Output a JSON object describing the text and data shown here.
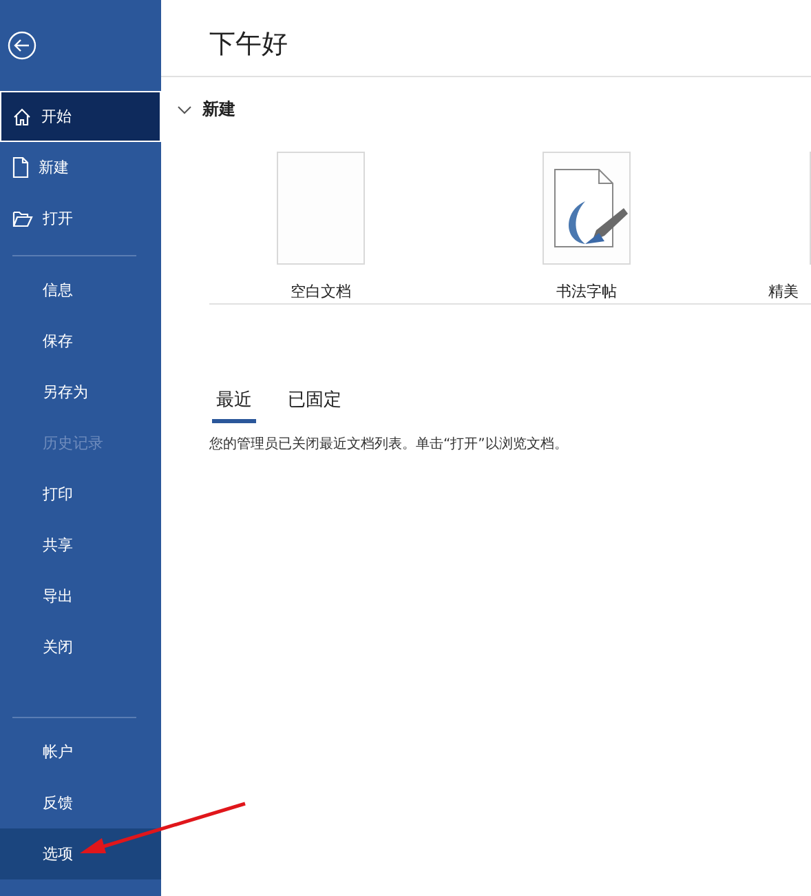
{
  "sidebar": {
    "top_items": [
      {
        "label": "开始",
        "selected": true,
        "highlighted": false,
        "disabled": false
      },
      {
        "label": "新建",
        "selected": false,
        "highlighted": false,
        "disabled": false
      },
      {
        "label": "打开",
        "selected": false,
        "highlighted": false,
        "disabled": false
      }
    ],
    "middle_items": [
      {
        "label": "信息",
        "selected": false,
        "highlighted": false,
        "disabled": false
      },
      {
        "label": "保存",
        "selected": false,
        "highlighted": false,
        "disabled": false
      },
      {
        "label": "另存为",
        "selected": false,
        "highlighted": false,
        "disabled": false
      },
      {
        "label": "历史记录",
        "selected": false,
        "highlighted": false,
        "disabled": true
      },
      {
        "label": "打印",
        "selected": false,
        "highlighted": false,
        "disabled": false
      },
      {
        "label": "共享",
        "selected": false,
        "highlighted": false,
        "disabled": false
      },
      {
        "label": "导出",
        "selected": false,
        "highlighted": false,
        "disabled": false
      },
      {
        "label": "关闭",
        "selected": false,
        "highlighted": false,
        "disabled": false
      }
    ],
    "bottom_items": [
      {
        "label": "帐户",
        "selected": false,
        "highlighted": false,
        "disabled": false
      },
      {
        "label": "反馈",
        "selected": false,
        "highlighted": false,
        "disabled": false
      },
      {
        "label": "选项",
        "selected": false,
        "highlighted": true,
        "disabled": false
      }
    ]
  },
  "greeting": "下午好",
  "new_section": {
    "title": "新建",
    "expanded": true,
    "templates": [
      {
        "kind": "blank",
        "label": "空白文档"
      },
      {
        "kind": "calligraphy",
        "label": "书法字帖"
      },
      {
        "kind": "partial",
        "label": "精美"
      }
    ]
  },
  "tabs": [
    {
      "label": "最近",
      "selected": true
    },
    {
      "label": "已固定",
      "selected": false
    }
  ],
  "message": "您的管理员已关闭最近文档列表。单击“打开”以浏览文档。"
}
